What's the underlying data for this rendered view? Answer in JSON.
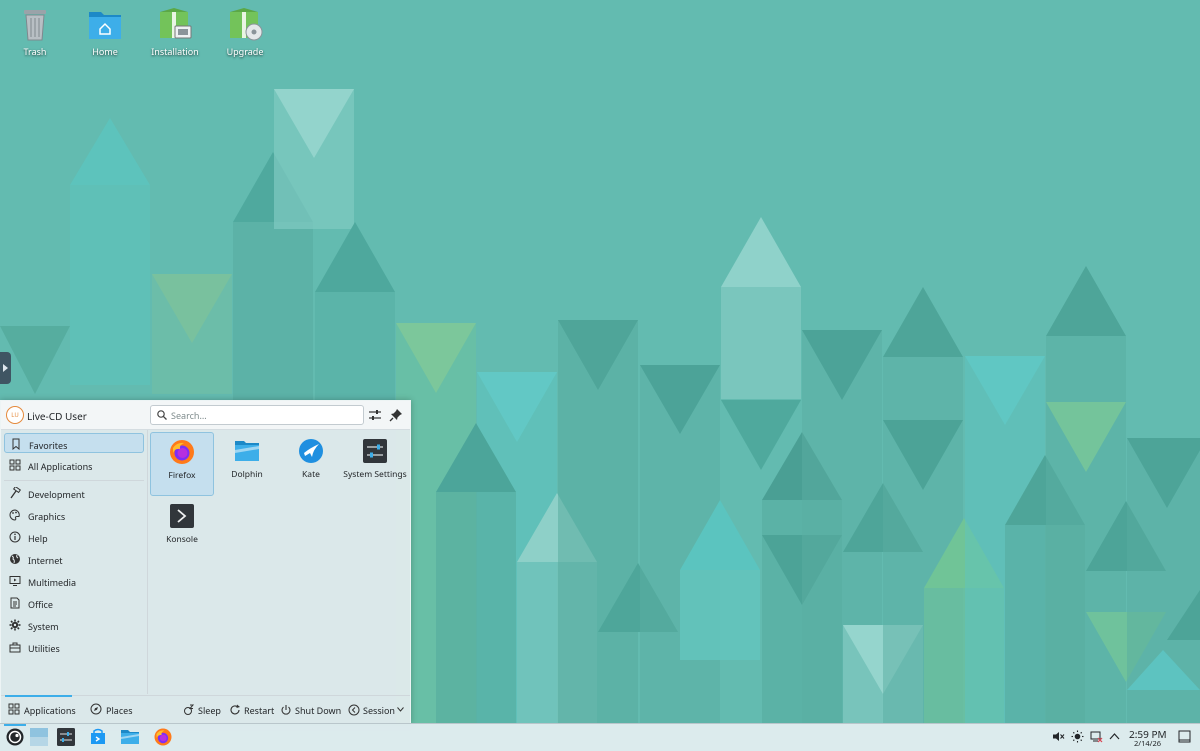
{
  "desktop": {
    "icons": [
      {
        "label": "Trash",
        "icon": "trash-icon"
      },
      {
        "label": "Home",
        "icon": "home-folder-icon"
      },
      {
        "label": "Installation",
        "icon": "installation-icon"
      },
      {
        "label": "Upgrade",
        "icon": "upgrade-icon"
      }
    ]
  },
  "launcher": {
    "user": {
      "initials": "LU",
      "name": "Live-CD User"
    },
    "search": {
      "placeholder": "Search...",
      "value": ""
    },
    "categories": [
      {
        "label": "Favorites",
        "icon": "bookmark-icon",
        "selected": true
      },
      {
        "label": "All Applications",
        "icon": "grid-icon"
      },
      {
        "label": "Development",
        "icon": "hammer-icon"
      },
      {
        "label": "Graphics",
        "icon": "palette-icon"
      },
      {
        "label": "Help",
        "icon": "help-icon"
      },
      {
        "label": "Internet",
        "icon": "globe-icon"
      },
      {
        "label": "Multimedia",
        "icon": "monitor-play-icon"
      },
      {
        "label": "Office",
        "icon": "document-icon"
      },
      {
        "label": "System",
        "icon": "gear-icon"
      },
      {
        "label": "Utilities",
        "icon": "toolbox-icon"
      }
    ],
    "favorites": [
      {
        "label": "Firefox",
        "icon": "firefox-icon",
        "selected": true
      },
      {
        "label": "Dolphin",
        "icon": "dolphin-folder-icon"
      },
      {
        "label": "Kate",
        "icon": "kate-icon"
      },
      {
        "label": "System Settings",
        "icon": "system-settings-icon"
      },
      {
        "label": "Konsole",
        "icon": "konsole-icon"
      }
    ],
    "footer": {
      "tabs": [
        {
          "label": "Applications",
          "icon": "grid-icon",
          "active": true
        },
        {
          "label": "Places",
          "icon": "compass-icon"
        }
      ],
      "actions": [
        {
          "label": "Sleep",
          "icon": "sleep-icon"
        },
        {
          "label": "Restart",
          "icon": "restart-icon"
        },
        {
          "label": "Shut Down",
          "icon": "power-icon"
        },
        {
          "label": "Session",
          "icon": "session-icon"
        }
      ]
    }
  },
  "taskbar": {
    "clock_time": "2:59 PM",
    "clock_date": "2/14/26",
    "tasks": [
      "app-launcher",
      "virtual-desktop-pager",
      "system-settings",
      "discover",
      "dolphin",
      "firefox"
    ],
    "tray": [
      "volume-muted",
      "brightness",
      "network-disconnected",
      "show-hidden",
      "show-desktop"
    ]
  },
  "colors": {
    "wallpaper": "#63bbb0",
    "accent": "#3daee9",
    "selection": "#c5dfee"
  }
}
